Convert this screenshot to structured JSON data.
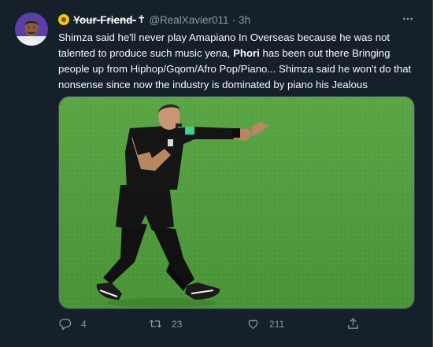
{
  "tweet": {
    "display_name": "Your-Friend-",
    "name_glyph": "✝",
    "handle": "@RealXavier011",
    "separator": "·",
    "time": "3h",
    "text_part1": "Shimza said he'll never play Amapiano In Overseas because he was not talented to produce such music yena, ",
    "text_bold": "Phori",
    "text_part2": " has been out there Bringing people up from Hiphop/Gqom/Afro Pop/Piano... Shimza said he won't do that nonsense since now the industry is dominated by piano his Jealous"
  },
  "actions": {
    "reply_count": "4",
    "retweet_count": "23",
    "like_count": "211"
  },
  "icons": {
    "more": "more-horizontal-icon",
    "reply": "reply-icon",
    "retweet": "retweet-icon",
    "like": "heart-icon",
    "share": "share-icon"
  },
  "colors": {
    "background": "#15202b",
    "text": "#f7f9f9",
    "muted": "#8b98a5",
    "pitch": "#4e9a3c"
  }
}
